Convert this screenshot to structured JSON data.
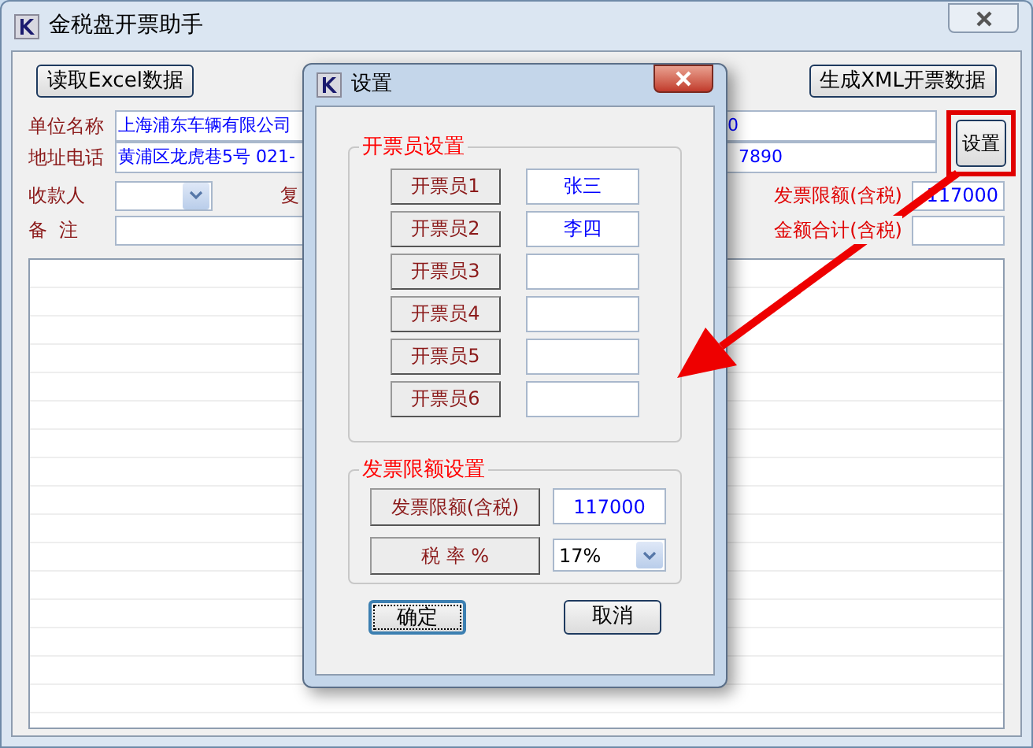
{
  "main_window": {
    "title": "金税盘开票助手",
    "buttons": [
      {
        "label": "读取Excel数据"
      },
      {
        "label": "生成XML开票数据"
      }
    ],
    "settings_button": {
      "label": "设置"
    },
    "unit_name": {
      "label": "单位名称",
      "value_start": "上海浦东车辆有限公司",
      "value_end": "0"
    },
    "address_phone": {
      "label": "地址电话",
      "value_start": "黄浦区龙虎巷5号 021-",
      "value_end": "7890"
    },
    "payee": {
      "label": "收款人"
    },
    "reviewer": {
      "label": "复"
    },
    "invoice_limit": {
      "label": "发票限额(含税)",
      "value": "117000"
    },
    "remarks": {
      "label": "备  注"
    },
    "amount_total": {
      "label": "金额合计(含税)"
    }
  },
  "dialog": {
    "title": "设置",
    "operators_group": {
      "title": "开票员设置",
      "rows": [
        {
          "label": "开票员1",
          "value": "张三"
        },
        {
          "label": "开票员2",
          "value": "李四"
        },
        {
          "label": "开票员3"
        },
        {
          "label": "开票员4"
        },
        {
          "label": "开票员5"
        },
        {
          "label": "开票员6"
        }
      ]
    },
    "limit_group": {
      "title": "发票限额设置",
      "limit": {
        "label": "发票限额(含税)",
        "value": "117000"
      },
      "tax_rate": {
        "label": "税 率 %",
        "value": "17%"
      }
    },
    "buttons": [
      {
        "label": "确定",
        "focused": true
      },
      {
        "label": "取消",
        "focused": false
      }
    ]
  }
}
